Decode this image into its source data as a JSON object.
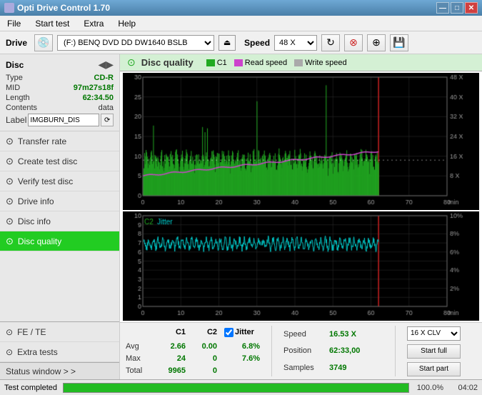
{
  "titleBar": {
    "title": "Opti Drive Control 1.70",
    "icon": "disc-icon",
    "minLabel": "—",
    "maxLabel": "□",
    "closeLabel": "✕"
  },
  "menuBar": {
    "items": [
      "File",
      "Start test",
      "Extra",
      "Help"
    ]
  },
  "driveBar": {
    "driveLabel": "Drive",
    "driveName": "(F:)  BENQ DVD DD DW1640 BSLB",
    "speedLabel": "Speed",
    "speedValue": "48 X"
  },
  "sidebar": {
    "discTitle": "Disc",
    "discInfo": {
      "typeLabel": "Type",
      "typeValue": "CD-R",
      "midLabel": "MID",
      "midValue": "97m27s18f",
      "lengthLabel": "Length",
      "lengthValue": "62:34.50",
      "contentsLabel": "Contents",
      "contentsValue": "data",
      "labelLabel": "Label",
      "labelValue": "IMGBURN_DIS"
    },
    "menuItems": [
      {
        "id": "transfer-rate",
        "label": "Transfer rate",
        "icon": "⊙"
      },
      {
        "id": "create-test-disc",
        "label": "Create test disc",
        "icon": "⊙"
      },
      {
        "id": "verify-test-disc",
        "label": "Verify test disc",
        "icon": "⊙"
      },
      {
        "id": "drive-info",
        "label": "Drive info",
        "icon": "⊙"
      },
      {
        "id": "disc-info",
        "label": "Disc info",
        "icon": "⊙"
      },
      {
        "id": "disc-quality",
        "label": "Disc quality",
        "icon": "⊙",
        "active": true
      }
    ],
    "feTe": "FE / TE",
    "extraTests": "Extra tests",
    "statusWindow": "Status window > >"
  },
  "discQuality": {
    "title": "Disc quality",
    "legend": {
      "c1Label": "C1",
      "c1Color": "#22aa22",
      "readSpeedLabel": "Read speed",
      "readSpeedColor": "#cc44cc",
      "writeSpeedLabel": "Write speed",
      "writeSpeedColor": "#aaaaaa"
    },
    "chart1": {
      "yMax": 30,
      "yTicks": [
        5,
        10,
        15,
        20,
        25,
        30
      ],
      "xMax": 80,
      "rightAxisMax": "48 X",
      "rightAxisTicks": [
        "8 X",
        "16 X",
        "24 X",
        "32 X",
        "40 X",
        "48 X"
      ]
    },
    "chart2": {
      "title": "C2",
      "jitterLabel": "Jitter",
      "yMax": 10,
      "xMax": 80,
      "rightAxisMax": "10%",
      "rightAxisTicks": [
        "2%",
        "4%",
        "6%",
        "8%",
        "10%"
      ]
    }
  },
  "stats": {
    "c1Label": "C1",
    "c2Label": "C2",
    "jitterLabel": "Jitter",
    "avgLabel": "Avg",
    "maxLabel": "Max",
    "totalLabel": "Total",
    "avgC1": "2.66",
    "avgC2": "0.00",
    "avgJitter": "6.8%",
    "maxC1": "24",
    "maxC2": "0",
    "maxJitter": "7.6%",
    "totalC1": "9965",
    "totalC2": "0",
    "speedLabel": "Speed",
    "speedValue": "16.53 X",
    "positionLabel": "Position",
    "positionValue": "62:33,00",
    "samplesLabel": "Samples",
    "samplesValue": "3749",
    "clvOption": "16 X CLV",
    "startFullLabel": "Start full",
    "startPartLabel": "Start part"
  },
  "statusBar": {
    "text": "Test completed",
    "progress": 100,
    "progressText": "100.0%",
    "time": "04:02"
  },
  "colors": {
    "accent": "#22cc22",
    "green": "#22aa22",
    "red": "#cc2222",
    "cyan": "#00cccc",
    "magenta": "#cc44cc"
  }
}
